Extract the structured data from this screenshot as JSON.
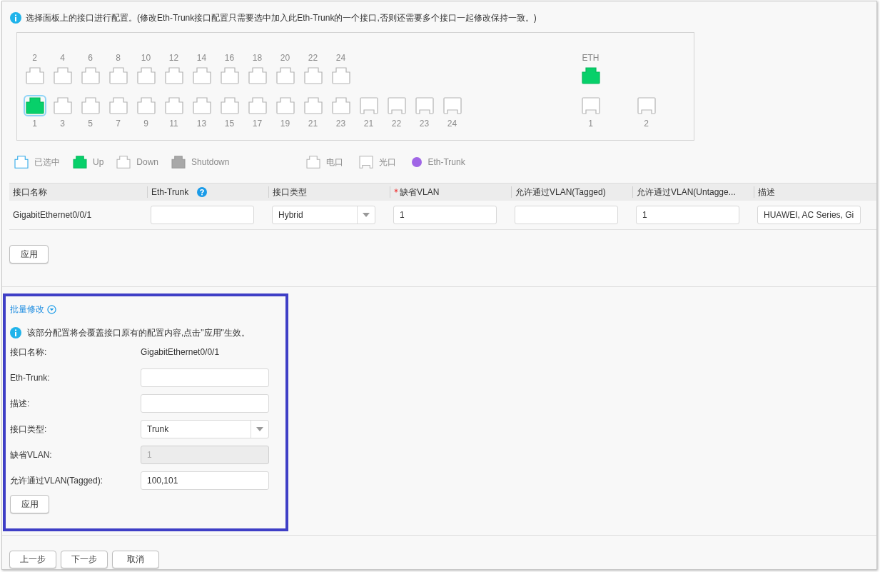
{
  "notice": "选择面板上的接口进行配置。(修改Eth-Trunk接口配置只需要选中加入此Eth-Trunk的一个接口,否则还需要多个接口一起修改保持一致。)",
  "panel": {
    "top_ports": [
      {
        "label": "2",
        "kind": "copper",
        "up": false,
        "selected": false
      },
      {
        "label": "4",
        "kind": "copper",
        "up": false,
        "selected": false
      },
      {
        "label": "6",
        "kind": "copper",
        "up": false,
        "selected": false
      },
      {
        "label": "8",
        "kind": "copper",
        "up": false,
        "selected": false
      },
      {
        "label": "10",
        "kind": "copper",
        "up": false,
        "selected": false
      },
      {
        "label": "12",
        "kind": "copper",
        "up": false,
        "selected": false
      },
      {
        "label": "14",
        "kind": "copper",
        "up": false,
        "selected": false
      },
      {
        "label": "16",
        "kind": "copper",
        "up": false,
        "selected": false
      },
      {
        "label": "18",
        "kind": "copper",
        "up": false,
        "selected": false
      },
      {
        "label": "20",
        "kind": "copper",
        "up": false,
        "selected": false
      },
      {
        "label": "22",
        "kind": "copper",
        "up": false,
        "selected": false
      },
      {
        "label": "24",
        "kind": "copper",
        "up": false,
        "selected": false
      }
    ],
    "bottom_ports": [
      {
        "label": "1",
        "kind": "copper",
        "up": true,
        "selected": true
      },
      {
        "label": "3",
        "kind": "copper",
        "up": false,
        "selected": false
      },
      {
        "label": "5",
        "kind": "copper",
        "up": false,
        "selected": false
      },
      {
        "label": "7",
        "kind": "copper",
        "up": false,
        "selected": false
      },
      {
        "label": "9",
        "kind": "copper",
        "up": false,
        "selected": false
      },
      {
        "label": "11",
        "kind": "copper",
        "up": false,
        "selected": false
      },
      {
        "label": "13",
        "kind": "copper",
        "up": false,
        "selected": false
      },
      {
        "label": "15",
        "kind": "copper",
        "up": false,
        "selected": false
      },
      {
        "label": "17",
        "kind": "copper",
        "up": false,
        "selected": false
      },
      {
        "label": "19",
        "kind": "copper",
        "up": false,
        "selected": false
      },
      {
        "label": "21",
        "kind": "copper",
        "up": false,
        "selected": false
      },
      {
        "label": "23",
        "kind": "copper",
        "up": false,
        "selected": false
      },
      {
        "label": "21",
        "kind": "fiber",
        "up": false,
        "selected": false
      },
      {
        "label": "22",
        "kind": "fiber",
        "up": false,
        "selected": false
      },
      {
        "label": "23",
        "kind": "fiber",
        "up": false,
        "selected": false
      },
      {
        "label": "24",
        "kind": "fiber",
        "up": false,
        "selected": false
      }
    ],
    "eth_port": {
      "label": "ETH",
      "kind": "copper",
      "up": true,
      "selected": false
    },
    "fiber_ports": [
      {
        "label": "1",
        "kind": "fiber",
        "up": false,
        "selected": false
      },
      {
        "label": "2",
        "kind": "fiber",
        "up": false,
        "selected": false
      }
    ]
  },
  "legend": {
    "status_items": [
      {
        "label": "已选中",
        "kind": "selected"
      },
      {
        "label": "Up",
        "kind": "up"
      },
      {
        "label": "Down",
        "kind": "down"
      },
      {
        "label": "Shutdown",
        "kind": "shutdown"
      }
    ],
    "type_items": [
      {
        "label": "电口",
        "kind": "copper"
      },
      {
        "label": "光口",
        "kind": "fiber"
      },
      {
        "label": "Eth-Trunk",
        "kind": "dot",
        "color": "#a066e6"
      }
    ]
  },
  "table": {
    "columns": [
      {
        "label": "接口名称",
        "required": false,
        "help": false
      },
      {
        "label": "Eth-Trunk",
        "required": false,
        "help": true
      },
      {
        "label": "接口类型",
        "required": false,
        "help": false
      },
      {
        "label": "缺省VLAN",
        "required": true,
        "help": false
      },
      {
        "label": "允许通过VLAN(Tagged)",
        "required": false,
        "help": false
      },
      {
        "label": "允许通过VLAN(Untagge...",
        "required": false,
        "help": false
      },
      {
        "label": "描述",
        "required": false,
        "help": false
      }
    ],
    "rows": [
      {
        "cells": [
          {
            "kind": "text",
            "value": "GigabitEthernet0/0/1"
          },
          {
            "kind": "input"
          },
          {
            "kind": "select",
            "value": "Hybrid"
          },
          {
            "kind": "input",
            "value": "1"
          },
          {
            "kind": "input"
          },
          {
            "kind": "input",
            "value": "1"
          },
          {
            "kind": "input",
            "value": "HUAWEI, AC Series, Gi"
          }
        ]
      }
    ]
  },
  "apply_button": "应用",
  "batch": {
    "title": "批量修改",
    "notice": "该部分配置将会覆盖接口原有的配置内容,点击\"应用\"生效。",
    "fields": [
      {
        "label": "接口名称:",
        "kind": "text",
        "value": "GigabitEthernet0/0/1"
      },
      {
        "label": "Eth-Trunk:",
        "kind": "input",
        "disabled": false
      },
      {
        "label": "描述:",
        "kind": "input",
        "disabled": false
      },
      {
        "label": "接口类型:",
        "kind": "select",
        "value": "Trunk"
      },
      {
        "label": "缺省VLAN:",
        "kind": "input",
        "value": "1",
        "disabled": true
      },
      {
        "label": "允许通过VLAN(Tagged):",
        "kind": "input",
        "value": "100,101",
        "disabled": false
      }
    ],
    "apply_button": "应用"
  },
  "nav_buttons": [
    "上一步",
    "下一步",
    "取消"
  ]
}
